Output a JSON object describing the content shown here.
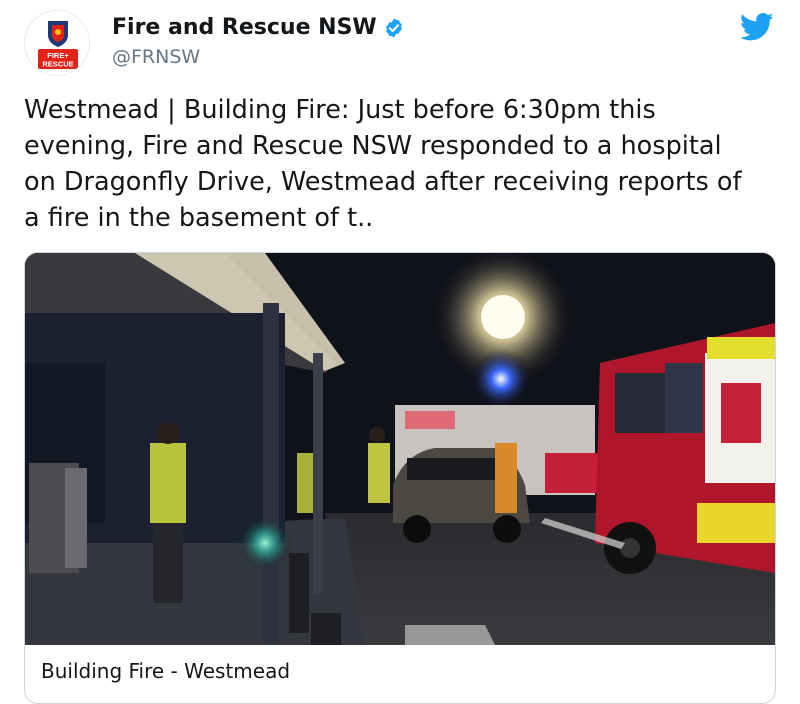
{
  "author": {
    "display_name": "Fire and Rescue NSW",
    "handle": "@FRNSW",
    "verified_icon": "verified-badge-icon",
    "logo_text_line1": "FIRE+",
    "logo_text_line2": "RESCUE"
  },
  "tweet": {
    "text_lines": [
      "Westmead | Building Fire: Just before 6:30pm this",
      "evening, Fire and Rescue NSW responded to a hospital",
      "on Dragonfly Drive, Westmead after receiving reports of",
      "a fire in the basement of t.."
    ]
  },
  "media": {
    "caption": "Building Fire - Westmead"
  },
  "icons": {
    "brand": "twitter-bird-icon"
  },
  "colors": {
    "twitter_blue": "#1da1f2",
    "fire_red": "#e2231a",
    "handle_gray": "#657786"
  }
}
